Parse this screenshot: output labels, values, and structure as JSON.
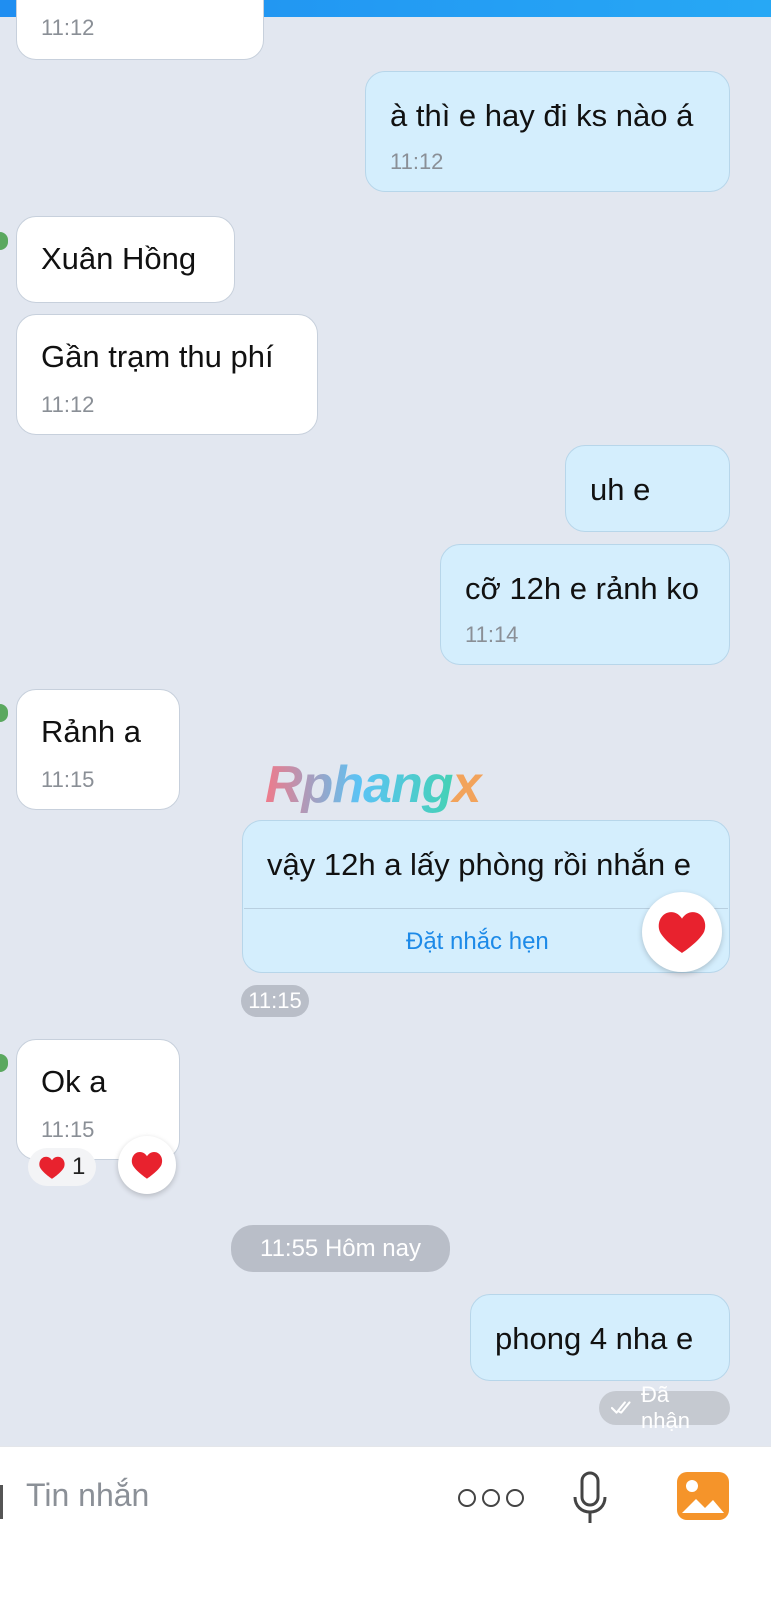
{
  "messages": [
    {
      "id": "m0",
      "side": "in",
      "text": "",
      "time": "11:12"
    },
    {
      "id": "m1",
      "side": "out",
      "text": "à thì e hay đi ks nào á",
      "time": "11:12"
    },
    {
      "id": "m2",
      "side": "in",
      "text": "Xuân Hồng",
      "time": ""
    },
    {
      "id": "m3",
      "side": "in",
      "text": "Gần trạm thu phí",
      "time": "11:12"
    },
    {
      "id": "m4",
      "side": "out",
      "text": "uh e",
      "time": ""
    },
    {
      "id": "m5",
      "side": "out",
      "text": "cỡ 12h e rảnh ko",
      "time": "11:14"
    },
    {
      "id": "m6",
      "side": "in",
      "text": "Rảnh a",
      "time": "11:15"
    },
    {
      "id": "m7",
      "side": "out",
      "text": "vậy 12h a lấy phòng rồi nhắn e",
      "time": "11:15",
      "action": "Đặt nhắc hẹn"
    },
    {
      "id": "m8",
      "side": "in",
      "text": "Ok a",
      "time": "11:15",
      "reaction_count": "1"
    },
    {
      "id": "m9",
      "side": "out",
      "text": "phong 4 nha e",
      "time": "",
      "status": "Đã nhận"
    }
  ],
  "date_separator": "11:55 Hôm nay",
  "watermark": {
    "main": "Rphang",
    "accent": "x"
  },
  "composer": {
    "placeholder": "Tin nhắn"
  },
  "icons": [
    "heart-icon",
    "more-icon",
    "microphone-icon",
    "gallery-icon",
    "double-check-icon"
  ],
  "colors": {
    "incoming": "#ffffff",
    "outgoing": "#d4eefd",
    "background": "#e2e7f0",
    "link": "#1d8ae8",
    "heart": "#e8222e"
  }
}
